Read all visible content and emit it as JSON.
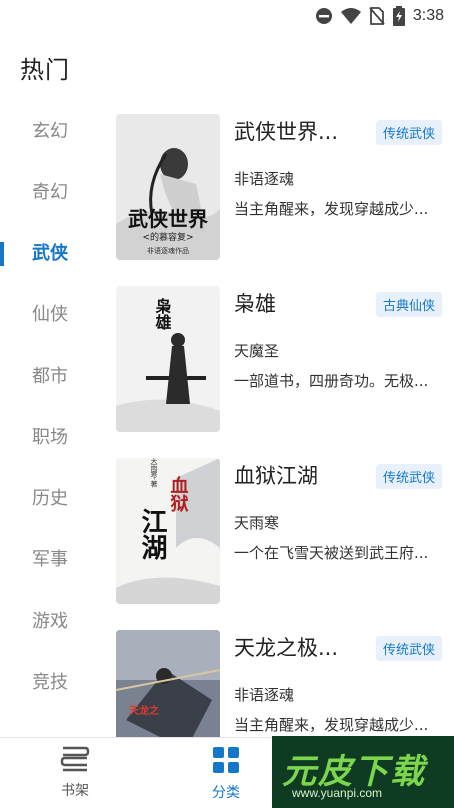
{
  "status": {
    "time": "3:38"
  },
  "header": {
    "title": "热门"
  },
  "sidebar": {
    "items": [
      {
        "label": "玄幻",
        "active": false
      },
      {
        "label": "奇幻",
        "active": false
      },
      {
        "label": "武侠",
        "active": true
      },
      {
        "label": "仙侠",
        "active": false
      },
      {
        "label": "都市",
        "active": false
      },
      {
        "label": "职场",
        "active": false
      },
      {
        "label": "历史",
        "active": false
      },
      {
        "label": "军事",
        "active": false
      },
      {
        "label": "游戏",
        "active": false
      },
      {
        "label": "竞技",
        "active": false
      }
    ],
    "accent": "#1677c8"
  },
  "books": [
    {
      "title": "武侠世界...",
      "tag": "传统武侠",
      "author": "非语逐魂",
      "desc": "当主角醒来，发现穿越成少...",
      "cover_text": "武侠世界",
      "cover_sub": "<的慕容复>",
      "cover_author": "非语逐魂作品"
    },
    {
      "title": "枭雄",
      "tag": "古典仙侠",
      "author": "天魔圣",
      "desc": "一部道书，四册奇功。无极...",
      "cover_text": "枭雄"
    },
    {
      "title": "血狱江湖",
      "tag": "传统武侠",
      "author": "天雨寒",
      "desc": "一个在飞雪天被送到武王府...",
      "cover_text": "血狱",
      "cover_sub": "江湖",
      "cover_author": "天雨寒·著"
    },
    {
      "title": "天龙之极...",
      "tag": "传统武侠",
      "author": "非语逐魂",
      "desc": "当主角醒来，发现穿越成少...",
      "cover_text": "天龙之"
    }
  ],
  "bottom_nav": {
    "shelf_label": "书架",
    "category_label": "分类"
  },
  "watermark": {
    "text": "元皮下载",
    "url": "www.yuanpi.com"
  }
}
